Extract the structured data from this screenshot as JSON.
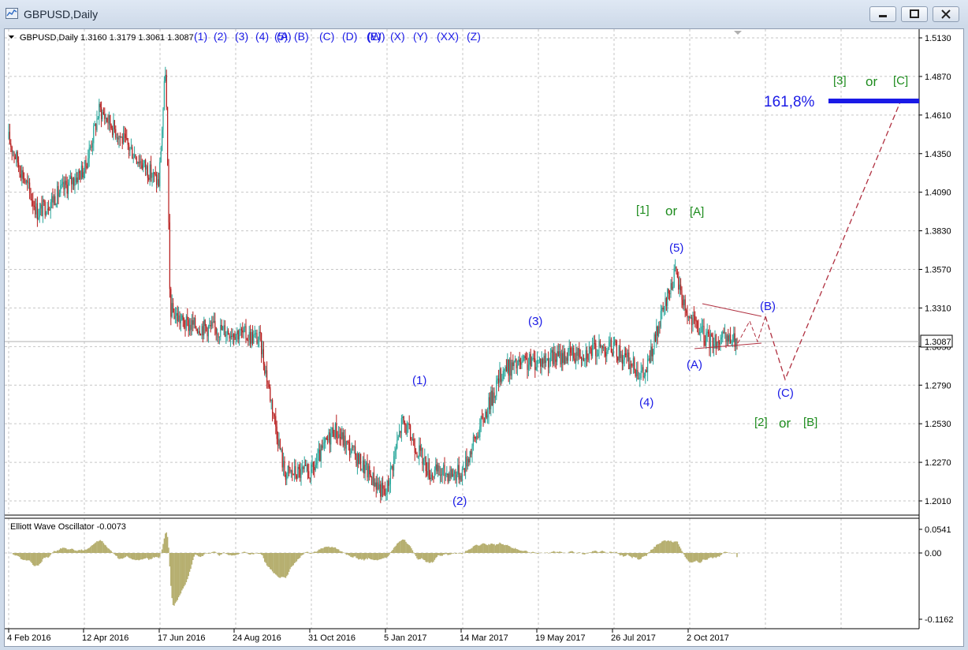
{
  "window": {
    "title": "GBPUSD,Daily"
  },
  "chart_header": {
    "info": "GBPUSD,Daily  1.3160 1.3179 1.3061 1.3087"
  },
  "wave_label_row": [
    "(1)",
    "(2)",
    "(3)",
    "(4)",
    "(5)",
    "(A)",
    "(B)",
    "(C)",
    "(D)",
    "(E)",
    "(W)",
    "(X)",
    "(Y)",
    "(XX)",
    "(Z)"
  ],
  "price_axis": [
    "1.5130",
    "1.4870",
    "1.4610",
    "1.4350",
    "1.4090",
    "1.3830",
    "1.3570",
    "1.3310",
    "1.3050",
    "1.2790",
    "1.2530",
    "1.2270",
    "1.2010"
  ],
  "current_price": "1.3087",
  "osc_axis": [
    "0.0541",
    "0.00",
    "-0.1162"
  ],
  "indicator": {
    "title": "Elliott Wave Oscillator -0.0073"
  },
  "date_axis": [
    "4 Feb 2016",
    "12 Apr 2016",
    "17 Jun 2016",
    "24 Aug 2016",
    "31 Oct 2016",
    "5 Jan 2017",
    "14 Mar 2017",
    "19 May 2017",
    "26 Jul 2017",
    "2 Oct 2017"
  ],
  "annotations": {
    "w1": "(1)",
    "w2": "(2)",
    "w3": "(3)",
    "w4": "(4)",
    "w5": "(5)",
    "wA": "(A)",
    "wB": "(B)",
    "wC": "(C)",
    "g1": "[1]",
    "or1": "or",
    "gA": "[A]",
    "g2": "[2]",
    "or2": "or",
    "gB": "[B]",
    "g3": "[3]",
    "or3": "or",
    "gC": "[C]",
    "fib": "161,8%"
  },
  "colors": {
    "bull": "#26a69a",
    "bear": "#b71c1c",
    "wave": "#1a1ae6",
    "green": "#1e8c1e",
    "osc": "#b5ae6e",
    "projection": "#b03040"
  },
  "chart_data": {
    "type": "candlestick",
    "symbol": "GBPUSD",
    "timeframe": "Daily",
    "ohlc_last": {
      "open": 1.316,
      "high": 1.3179,
      "low": 1.3061,
      "close": 1.3087
    },
    "ylim": [
      1.195,
      1.518
    ],
    "close_path": [
      [
        "4 Feb 2016",
        1.445
      ],
      [
        "1 Mar 2016",
        1.395
      ],
      [
        "12 Apr 2016",
        1.425
      ],
      [
        "25 Apr 2016",
        1.465
      ],
      [
        "15 May 2016",
        1.445
      ],
      [
        "17 Jun 2016",
        1.415
      ],
      [
        "23 Jun 2016",
        1.495
      ],
      [
        "27 Jun 2016",
        1.33
      ],
      [
        "10 Jul 2016",
        1.32
      ],
      [
        "24 Aug 2016",
        1.315
      ],
      [
        "15 Sep 2016",
        1.31
      ],
      [
        "7 Oct 2016",
        1.22
      ],
      [
        "31 Oct 2016",
        1.22
      ],
      [
        "20 Nov 2016",
        1.25
      ],
      [
        "5 Jan 2017",
        1.205
      ],
      [
        "20 Jan 2017",
        1.255
      ],
      [
        "14 Feb 2017",
        1.22
      ],
      [
        "14 Mar 2017",
        1.22
      ],
      [
        "20 Apr 2017",
        1.29
      ],
      [
        "19 May 2017",
        1.295
      ],
      [
        "26 Jul 2017",
        1.305
      ],
      [
        "24 Aug 2017",
        1.285
      ],
      [
        "20 Sep 2017",
        1.355
      ],
      [
        "2 Oct 2017",
        1.325
      ],
      [
        "20 Oct 2017",
        1.309
      ]
    ],
    "oscillator": {
      "name": "Elliott Wave Oscillator",
      "last": -0.0073,
      "ylim": [
        -0.1162,
        0.0541
      ]
    }
  }
}
